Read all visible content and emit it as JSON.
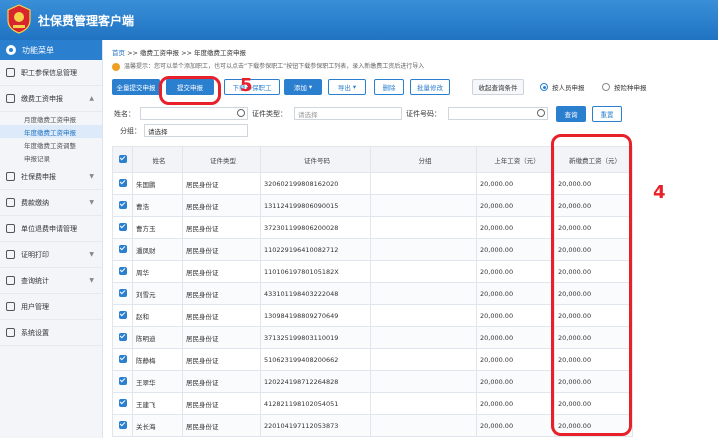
{
  "header": {
    "title": "社保费管理客户端"
  },
  "sidebar": {
    "menu_title": "功能菜单",
    "items": [
      {
        "label": "职工参保信息管理"
      },
      {
        "label": "缴费工资申报",
        "expanded": true,
        "children": [
          {
            "label": "月度缴费工资申报"
          },
          {
            "label": "年度缴费工资申报",
            "active": true
          },
          {
            "label": "年度缴费工资调整"
          },
          {
            "label": "申报记录"
          }
        ]
      },
      {
        "label": "社保费申报"
      },
      {
        "label": "费款缴纳"
      },
      {
        "label": "单位退费申请管理"
      },
      {
        "label": "证明打印"
      },
      {
        "label": "查询统计"
      },
      {
        "label": "用户管理"
      },
      {
        "label": "系统设置"
      }
    ]
  },
  "breadcrumb": {
    "home": "首页",
    "rest": ">> 缴费工资申报 >> 年度缴费工资申报"
  },
  "tip": "温馨提示：您可以单个添加职工，也可以点击“下载参保职工”按钮下载参保职工列表，录入新缴费工资后进行导入",
  "toolbar": {
    "btn_submit_all": "全量提交申报",
    "btn_submit": "提交申报",
    "btn_download": "下载参保职工",
    "btn_add": "添加",
    "btn_export": "导出",
    "btn_delete": "删除",
    "btn_batch_edit": "批量修改",
    "btn_collapse": "收起查询条件",
    "radio_person": "按人员申报",
    "radio_insurance": "按险种申报"
  },
  "filters": {
    "name_label": "姓名：",
    "idtype_label": "证件类型：",
    "idtype_placeholder": "请选择",
    "idno_label": "证件号码：",
    "group_label": "分组：",
    "group_placeholder": "请选择",
    "btn_query": "查询",
    "btn_reset": "重置"
  },
  "table": {
    "headers": [
      "姓名",
      "证件类型",
      "证件号码",
      "分组",
      "上年工资（元）",
      "新缴费工资（元）"
    ],
    "rows": [
      [
        "朱国鹏",
        "居民身份证",
        "320602199808162020",
        "",
        "20,000.00",
        "20,000.00"
      ],
      [
        "曹浩",
        "居民身份证",
        "131124199806090015",
        "",
        "20,000.00",
        "20,000.00"
      ],
      [
        "曹方玉",
        "居民身份证",
        "372301199806200028",
        "",
        "20,000.00",
        "20,000.00"
      ],
      [
        "潘凤财",
        "居民身份证",
        "110229196410082712",
        "",
        "20,000.00",
        "20,000.00"
      ],
      [
        "周华",
        "居民身份证",
        "11010619780105182X",
        "",
        "20,000.00",
        "20,000.00"
      ],
      [
        "刘雪元",
        "居民身份证",
        "433101198403222048",
        "",
        "20,000.00",
        "20,000.00"
      ],
      [
        "赵和",
        "居民身份证",
        "130984198809270649",
        "",
        "20,000.00",
        "20,000.00"
      ],
      [
        "陈明迪",
        "居民身份证",
        "371325199803110019",
        "",
        "20,000.00",
        "20,000.00"
      ],
      [
        "陈静梅",
        "居民身份证",
        "510623199408200662",
        "",
        "20,000.00",
        "20,000.00"
      ],
      [
        "王翠华",
        "居民身份证",
        "120224198712264828",
        "",
        "20,000.00",
        "20,000.00"
      ],
      [
        "王建飞",
        "居民身份证",
        "412821198102054051",
        "",
        "20,000.00",
        "20,000.00"
      ],
      [
        "关长海",
        "居民身份证",
        "220104197112053873",
        "",
        "20,000.00",
        "20,000.00"
      ]
    ]
  },
  "annotations": {
    "submit_marker": "5",
    "column_marker": "4"
  },
  "colors": {
    "header": "#1f73c2",
    "accent": "#2b7fcf",
    "annotation": "#e8202a"
  }
}
